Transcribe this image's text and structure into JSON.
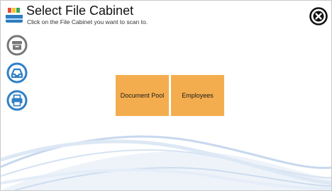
{
  "header": {
    "title": "Select File Cabinet",
    "subtitle": "Click on the File Cabinet you want to scan to.",
    "logo_icon": "app-logo-icon"
  },
  "close_icon": "close-circle-icon",
  "sidebar": {
    "buttons": [
      {
        "icon": "archive-box-icon",
        "color": "#777777"
      },
      {
        "icon": "inbox-tray-icon",
        "color": "#2f7fc6"
      },
      {
        "icon": "printer-icon",
        "color": "#2f7fc6"
      }
    ]
  },
  "cabinets": [
    {
      "label": "Document Pool"
    },
    {
      "label": "Employees"
    }
  ],
  "colors": {
    "accent_blue": "#2f7fc6",
    "cabinet_tile": "#f4ad4e",
    "wave": "#c7d8ee"
  }
}
